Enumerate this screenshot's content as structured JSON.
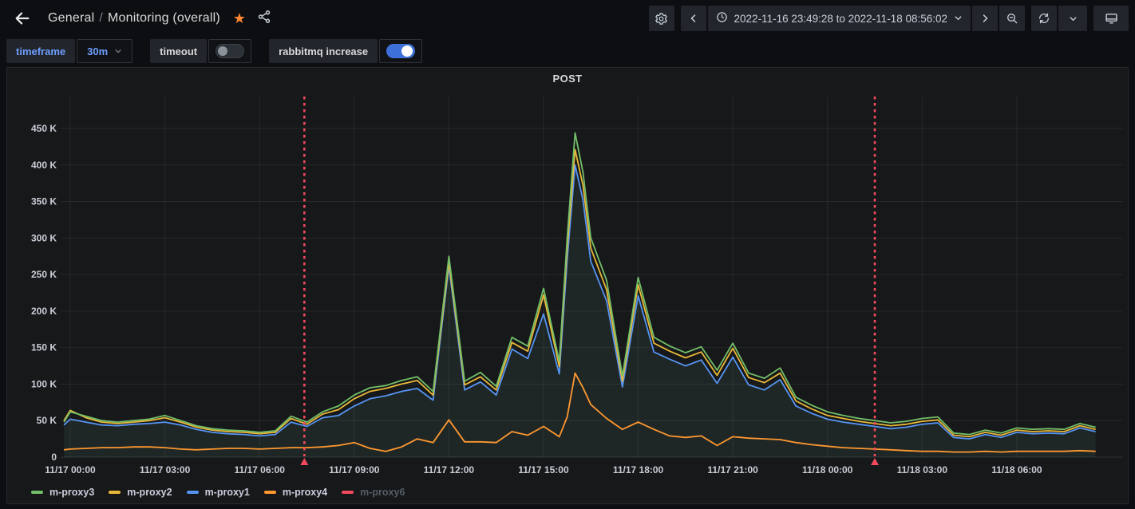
{
  "topbar": {
    "breadcrumb": {
      "section": "General",
      "separator": "/",
      "page": "Monitoring (overall)"
    },
    "time_range": "2022-11-16 23:49:28 to 2022-11-18 08:56:02"
  },
  "controls": {
    "timeframe_label": "timeframe",
    "timeframe_value": "30m",
    "timeout_label": "timeout",
    "timeout_on": false,
    "rabbitmq_label": "rabbitmq increase",
    "rabbitmq_on": true
  },
  "panel": {
    "title": "POST"
  },
  "colors": {
    "green": "#73BF69",
    "yellow": "#EAB839",
    "blue": "#5794F2",
    "orange": "#FF9830",
    "red": "#F2495C",
    "accent_blue": "#6e9fff",
    "toggle_on": "#3d71d9",
    "panel_bg": "#161819",
    "page_bg": "#0d0e11",
    "grid": "rgba(255,255,255,0.07)",
    "axis_text": "#c9cdd6",
    "area_fill": "rgba(95,150,135,0.13)",
    "star": "#ff8833"
  },
  "chart_data": {
    "type": "line",
    "title": "POST",
    "unit": "K",
    "ylim": [
      0,
      490
    ],
    "grid": true,
    "legend_position": "bottom",
    "x_hours": [
      -0.2,
      0,
      0.5,
      1,
      1.5,
      2,
      2.5,
      3,
      3.5,
      4,
      4.5,
      5,
      5.5,
      6,
      6.5,
      7,
      7.5,
      8,
      8.5,
      9,
      9.5,
      10,
      10.5,
      11,
      11.5,
      12,
      12.5,
      13,
      13.5,
      14,
      14.5,
      15,
      15.5,
      15.75,
      16,
      16.25,
      16.5,
      17,
      17.5,
      18,
      18.5,
      19,
      19.5,
      20,
      20.5,
      21,
      21.5,
      22,
      22.5,
      23,
      23.5,
      24,
      24.5,
      25,
      25.5,
      26,
      26.5,
      27,
      27.5,
      28,
      28.5,
      29,
      29.5,
      30,
      30.5,
      31,
      31.5,
      32,
      32.5
    ],
    "series": [
      {
        "name": "m-proxy3",
        "color": "#73BF69",
        "hidden": false,
        "values": [
          48,
          62,
          56,
          50,
          48,
          50,
          52,
          57,
          50,
          43,
          39,
          37,
          36,
          34,
          36,
          56,
          48,
          62,
          70,
          85,
          95,
          98,
          105,
          110,
          90,
          275,
          104,
          116,
          97,
          164,
          152,
          231,
          131,
          300,
          444,
          390,
          300,
          242,
          111,
          246,
          164,
          152,
          143,
          151,
          119,
          156,
          115,
          108,
          122,
          82,
          71,
          62,
          57,
          53,
          50,
          47,
          49,
          53,
          55,
          33,
          31,
          37,
          33,
          40,
          38,
          39,
          38,
          46,
          41
        ]
      },
      {
        "name": "m-proxy2",
        "color": "#EAB839",
        "hidden": false,
        "values": [
          50,
          64,
          54,
          48,
          46,
          48,
          50,
          54,
          48,
          41,
          37,
          35,
          34,
          32,
          34,
          53,
          45,
          59,
          65,
          80,
          90,
          94,
          100,
          105,
          85,
          267,
          99,
          110,
          92,
          157,
          145,
          222,
          124,
          286,
          421,
          372,
          286,
          229,
          104,
          236,
          156,
          145,
          136,
          144,
          112,
          149,
          109,
          102,
          115,
          77,
          66,
          57,
          53,
          49,
          46,
          43,
          45,
          49,
          51,
          30,
          28,
          34,
          30,
          37,
          35,
          36,
          35,
          43,
          38
        ]
      },
      {
        "name": "m-proxy1",
        "color": "#5794F2",
        "hidden": false,
        "fill": true,
        "values": [
          44,
          52,
          48,
          44,
          43,
          45,
          46,
          48,
          44,
          38,
          34,
          32,
          31,
          29,
          31,
          48,
          42,
          54,
          57,
          70,
          80,
          84,
          90,
          94,
          78,
          261,
          92,
          103,
          85,
          148,
          135,
          196,
          114,
          270,
          400,
          352,
          268,
          214,
          96,
          221,
          144,
          134,
          125,
          133,
          101,
          137,
          99,
          92,
          106,
          70,
          60,
          52,
          48,
          45,
          42,
          39,
          41,
          45,
          47,
          27,
          25,
          31,
          27,
          34,
          32,
          33,
          32,
          40,
          35
        ]
      },
      {
        "name": "m-proxy4",
        "color": "#FF9830",
        "hidden": false,
        "values": [
          10,
          11,
          12,
          13,
          13,
          14,
          14,
          13,
          11,
          10,
          11,
          12,
          12,
          11,
          12,
          13,
          13,
          14,
          16,
          20,
          12,
          8,
          14,
          25,
          20,
          51,
          21,
          21,
          20,
          35,
          30,
          42,
          28,
          55,
          115,
          95,
          72,
          53,
          38,
          48,
          38,
          29,
          27,
          29,
          16,
          28,
          26,
          25,
          24,
          20,
          17,
          15,
          13,
          12,
          11,
          10,
          9,
          8,
          8,
          7,
          7,
          8,
          7,
          8,
          8,
          8,
          8,
          9,
          8
        ]
      },
      {
        "name": "m-proxy6",
        "color": "#F2495C",
        "hidden": true,
        "values": []
      }
    ],
    "y_ticks": [
      {
        "v": 0,
        "label": "0"
      },
      {
        "v": 50,
        "label": "50 K"
      },
      {
        "v": 100,
        "label": "100 K"
      },
      {
        "v": 150,
        "label": "150 K"
      },
      {
        "v": 200,
        "label": "200 K"
      },
      {
        "v": 250,
        "label": "250 K"
      },
      {
        "v": 300,
        "label": "300 K"
      },
      {
        "v": 350,
        "label": "350 K"
      },
      {
        "v": 400,
        "label": "400 K"
      },
      {
        "v": 450,
        "label": "450 K"
      }
    ],
    "x_ticks": [
      {
        "t": 0,
        "label": "11/17 00:00"
      },
      {
        "t": 3,
        "label": "11/17 03:00"
      },
      {
        "t": 6,
        "label": "11/17 06:00"
      },
      {
        "t": 9,
        "label": "11/17 09:00"
      },
      {
        "t": 12,
        "label": "11/17 12:00"
      },
      {
        "t": 15,
        "label": "11/17 15:00"
      },
      {
        "t": 18,
        "label": "11/17 18:00"
      },
      {
        "t": 21,
        "label": "11/17 21:00"
      },
      {
        "t": 24,
        "label": "11/18 00:00"
      },
      {
        "t": 27,
        "label": "11/18 03:00"
      },
      {
        "t": 30,
        "label": "11/18 06:00"
      }
    ],
    "annotations_hours": [
      7.42,
      25.5
    ],
    "annotation_color": "#F2495C"
  }
}
